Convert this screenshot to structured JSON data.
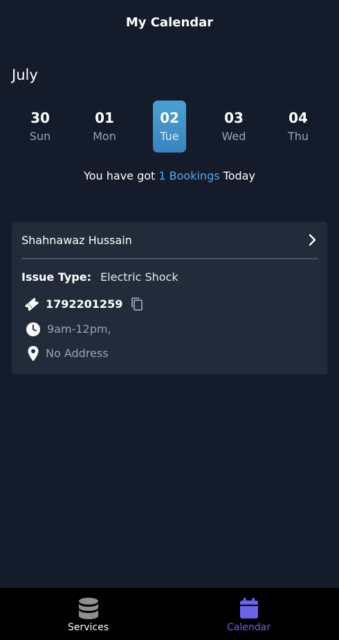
{
  "header": {
    "title": "My Calendar"
  },
  "calendar": {
    "month": "July",
    "days": [
      {
        "num": "30",
        "weekday": "Sun"
      },
      {
        "num": "01",
        "weekday": "Mon"
      },
      {
        "num": "02",
        "weekday": "Tue"
      },
      {
        "num": "03",
        "weekday": "Wed"
      },
      {
        "num": "04",
        "weekday": "Thu"
      }
    ],
    "selected_day": "02"
  },
  "summary": {
    "prefix": "You have got ",
    "highlight": "1 Bookings",
    "suffix": " Today"
  },
  "booking": {
    "name": "Shahnawaz Hussain",
    "issue_label": "Issue Type:",
    "issue_value": "Electric Shock",
    "ticket_number": "1792201259",
    "time": "9am-12pm,",
    "address": "No Address"
  },
  "nav": {
    "items": [
      {
        "label": "Services",
        "icon": "database-icon"
      },
      {
        "label": "Calendar",
        "icon": "calendar-icon",
        "active": true
      }
    ]
  },
  "colors": {
    "background": "#141b2b",
    "card": "#222b3a",
    "selected_day": "#3b84c0",
    "highlight_text": "#5da8e6",
    "nav_active": "#6a63e8",
    "nav_background": "#000000"
  }
}
